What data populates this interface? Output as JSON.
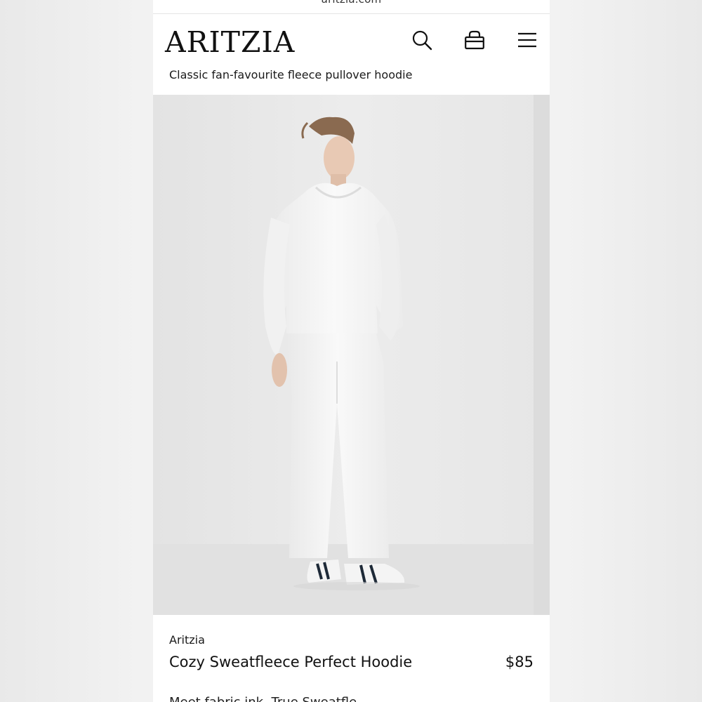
{
  "browser": {
    "url": "aritzia.com"
  },
  "header": {
    "logo": "ARITZIA",
    "tagline": "Classic fan-favourite fleece pullover hoodie",
    "icons": [
      "search-icon",
      "bag-icon",
      "menu-icon"
    ]
  },
  "product": {
    "image_alt": "Model wearing white hoodie and white sweatpants",
    "brand": "Aritzia",
    "name": "Cozy Sweatfleece Perfect Hoodie",
    "price": "$85",
    "description_partial": "Meet fabric ink. True Sweatfle"
  },
  "colors": {
    "page_bg": "#ededed",
    "surface": "#ffffff",
    "text": "#111111",
    "image_bg": "#e8e8e8"
  }
}
